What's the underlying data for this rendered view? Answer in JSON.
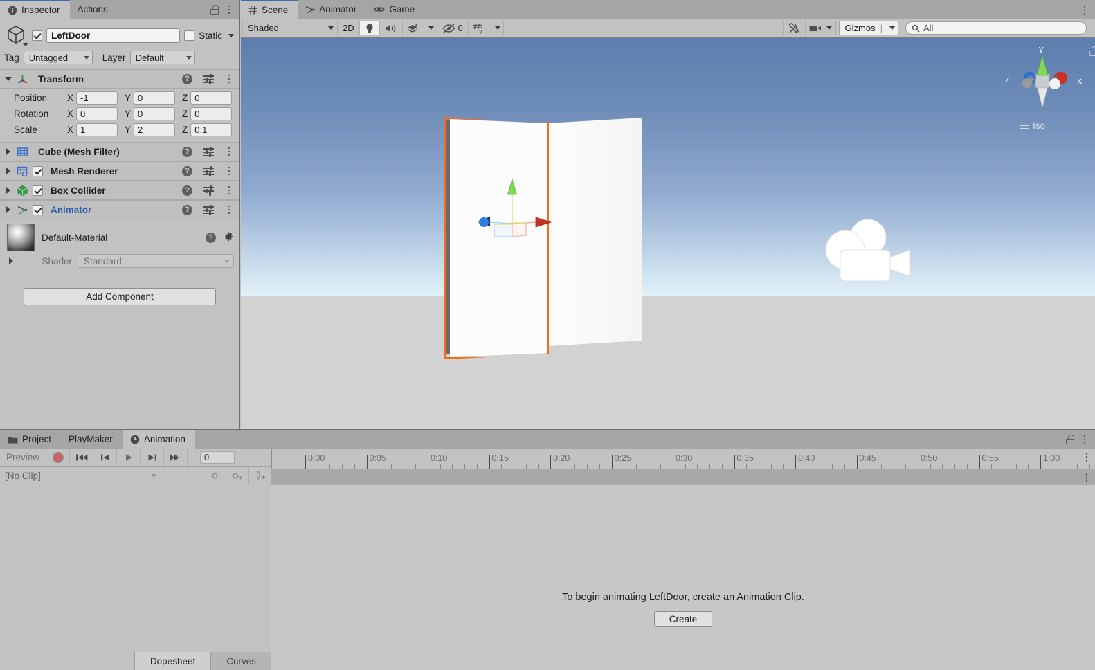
{
  "inspector": {
    "tabs": [
      {
        "label": "Inspector",
        "icon": "info-icon",
        "active": true
      },
      {
        "label": "Actions",
        "icon": "",
        "active": false
      }
    ],
    "object_name": "LeftDoor",
    "enabled_checkbox": true,
    "static_label": "Static",
    "static_checkbox": false,
    "tag_label": "Tag",
    "tag_value": "Untagged",
    "layer_label": "Layer",
    "layer_value": "Default",
    "transform": {
      "title": "Transform",
      "rows": [
        {
          "label": "Position",
          "x": "-1",
          "y": "0",
          "z": "0"
        },
        {
          "label": "Rotation",
          "x": "0",
          "y": "0",
          "z": "0"
        },
        {
          "label": "Scale",
          "x": "1",
          "y": "2",
          "z": "0.1"
        }
      ],
      "axis_x": "X",
      "axis_y": "Y",
      "axis_z": "Z"
    },
    "components": [
      {
        "title": "Cube (Mesh Filter)",
        "has_checkbox": false,
        "checked": false,
        "link": false,
        "icon": "mesh-filter-icon"
      },
      {
        "title": "Mesh Renderer",
        "has_checkbox": true,
        "checked": true,
        "link": false,
        "icon": "mesh-renderer-icon"
      },
      {
        "title": "Box Collider",
        "has_checkbox": true,
        "checked": true,
        "link": false,
        "icon": "box-collider-icon"
      },
      {
        "title": "Animator",
        "has_checkbox": true,
        "checked": true,
        "link": true,
        "icon": "animator-icon"
      }
    ],
    "material": {
      "name": "Default-Material",
      "shader_label": "Shader",
      "shader_value": "Standard"
    },
    "add_component_label": "Add Component"
  },
  "scene": {
    "tabs": [
      {
        "label": "Scene",
        "icon": "grid-icon",
        "active": true
      },
      {
        "label": "Animator",
        "icon": "animator-icon",
        "active": false
      },
      {
        "label": "Game",
        "icon": "gamepad-icon",
        "active": false
      }
    ],
    "toolbar": {
      "draw_mode": "Shaded",
      "two_d_label": "2D",
      "lighting_icon": "lightbulb-icon",
      "audio_icon": "speaker-icon",
      "fx_icon": "effects-icon",
      "hidden_count": "0",
      "hidden_icon": "hidden-eye-icon",
      "grid_icon": "grid-snap-icon",
      "tools_icon": "tools-icon",
      "camera_icon": "scene-camera-icon",
      "gizmos_label": "Gizmos",
      "search_placeholder": "All",
      "search_value": "",
      "search_icon": "search-icon"
    },
    "orientation_gizmo": {
      "x_label": "x",
      "y_label": "y",
      "z_label": "z",
      "projection": "Iso"
    },
    "objects": {
      "selected_outline_color": "#f96a1b",
      "camera_gizmo": "camera-gizmo-icon"
    }
  },
  "animation": {
    "tabs": [
      {
        "label": "Project",
        "icon": "folder-icon",
        "active": false
      },
      {
        "label": "PlayMaker",
        "icon": "",
        "active": false
      },
      {
        "label": "Animation",
        "icon": "clock-icon",
        "active": true
      }
    ],
    "preview_label": "Preview",
    "record_icon": "record-icon",
    "controls": [
      {
        "name": "first-frame-button",
        "icon": "skip-back-icon"
      },
      {
        "name": "prev-frame-button",
        "icon": "step-back-icon"
      },
      {
        "name": "play-button",
        "icon": "play-icon"
      },
      {
        "name": "next-frame-button",
        "icon": "step-forward-icon"
      },
      {
        "name": "last-frame-button",
        "icon": "skip-forward-icon"
      }
    ],
    "frame_value": "0",
    "clip_selector": "[No Clip]",
    "key_buttons": [
      {
        "name": "add-keyframe-button",
        "icon": "keyframe-icon"
      },
      {
        "name": "add-property-keyframe-button",
        "icon": "keyframe-plus-icon"
      },
      {
        "name": "add-event-button",
        "icon": "event-plus-icon"
      }
    ],
    "timeline_labels": [
      "0:00",
      "0:05",
      "0:10",
      "0:15",
      "0:20",
      "0:25",
      "0:30",
      "0:35",
      "0:40",
      "0:45",
      "0:50",
      "0:55",
      "1:00"
    ],
    "empty_message": "To begin animating LeftDoor, create an Animation Clip.",
    "create_label": "Create",
    "bottom_tabs": [
      {
        "label": "Dopesheet",
        "active": true
      },
      {
        "label": "Curves",
        "active": false
      }
    ]
  }
}
